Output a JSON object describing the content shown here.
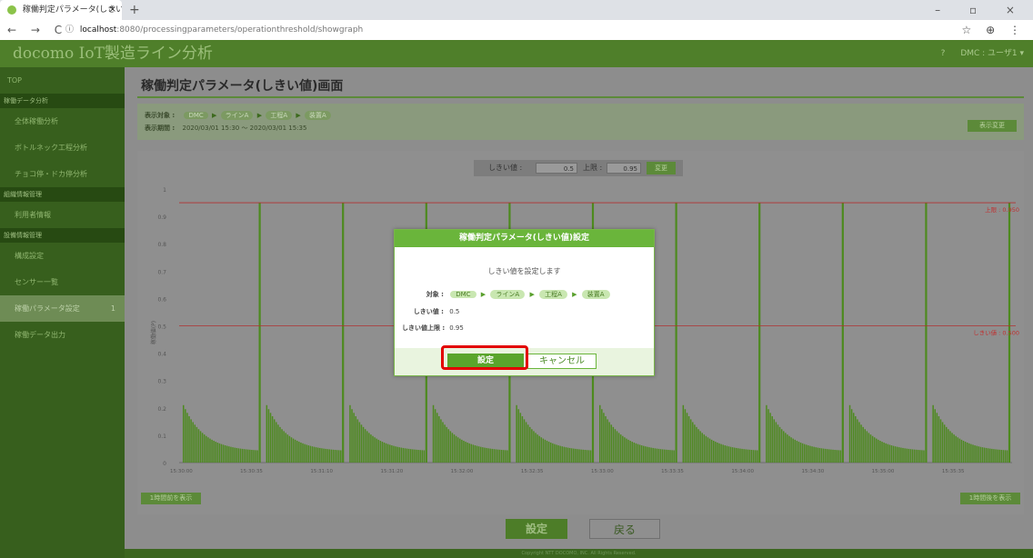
{
  "browser": {
    "tab_title": "稼働判定パラメータ(しきい値)画面",
    "tab_close": "×",
    "new_tab": "+",
    "window_controls": "–   ▫   ×",
    "nav_icons": "← → C",
    "url_host": "localhost",
    "url_path": ":8080/processingparameters/operationthreshold/showgraph",
    "info_icon": "ⓘ",
    "right_icons": "☆ ⊕ ⋮"
  },
  "app": {
    "brand": "docomo IoT製造ライン分析",
    "help_icon": "?",
    "user": "DMC : ユーザ1 ▾"
  },
  "sidebar": {
    "top": "TOP",
    "sections": [
      {
        "title": "稼働データ分析",
        "items": [
          "全体稼働分析",
          "ボトルネック工程分析",
          "チョコ停・ドカ停分析"
        ]
      },
      {
        "title": "組織情報管理",
        "items": [
          "利用者情報"
        ]
      },
      {
        "title": "設備情報管理",
        "items": [
          "構成設定",
          "センサー一覧",
          "稼働パラメータ設定",
          "稼働データ出力"
        ]
      }
    ],
    "active_num": "1"
  },
  "page": {
    "title": "稼働判定パラメータ(しきい値)画面",
    "info": {
      "target_label": "表示対象 :",
      "path": [
        "DMC",
        "ラインA",
        "工程A",
        "装置A"
      ],
      "arrow": "▶",
      "period_label": "表示期間 :",
      "period": "2020/03/01 15:30 ～ 2020/03/01 15:35",
      "change_button": "表示変更"
    },
    "threshold_bar": {
      "threshold_label": "しきい値 :",
      "threshold_value": "0.5",
      "upper_label": "上限 :",
      "upper_value": "0.95",
      "apply_button": "変更"
    },
    "prev_button": "1時間前を表示",
    "next_button": "1時間後を表示",
    "set_button": "設定",
    "back_button": "戻る",
    "footer": "Copyright NTT DOCOMO, INC. All Rights Reserved."
  },
  "chart_data": {
    "type": "bar",
    "ylabel": "稼働値(P)",
    "yticks": [
      "0",
      "0.1",
      "0.2",
      "0.3",
      "0.4",
      "0.5",
      "0.6",
      "0.7",
      "0.8",
      "0.9",
      "1"
    ],
    "ylim": [
      0,
      1
    ],
    "xticks": [
      "15:30:00",
      "15:30:35",
      "15:31:10",
      "15:31:20",
      "15:32:00",
      "15:32:35",
      "15:33:00",
      "15:33:35",
      "15:34:00",
      "15:34:30",
      "15:35:00",
      "15:35:35"
    ],
    "upper_line": {
      "value": 0.95,
      "label": "上限 : 0.950"
    },
    "threshold_line": {
      "value": 0.5,
      "label": "しきい値 : 0.500"
    },
    "bar_color": "#4d8a1e",
    "cycles": 10,
    "cycle_peak": 0.95,
    "cycle_start": 0.21,
    "cycle_end": 0.04,
    "bars_per_cycle": 40
  },
  "modal": {
    "title": "稼働判定パラメータ(しきい値)設定",
    "message": "しきい値を設定します",
    "target_label": "対象 :",
    "path": [
      "DMC",
      "ラインA",
      "工程A",
      "装置A"
    ],
    "arrow": "▶",
    "threshold_label": "しきい値 :",
    "threshold_value": "0.5",
    "upper_label": "しきい値上限 :",
    "upper_value": "0.95",
    "ok_button": "設定",
    "cancel_button": "キャンセル"
  }
}
